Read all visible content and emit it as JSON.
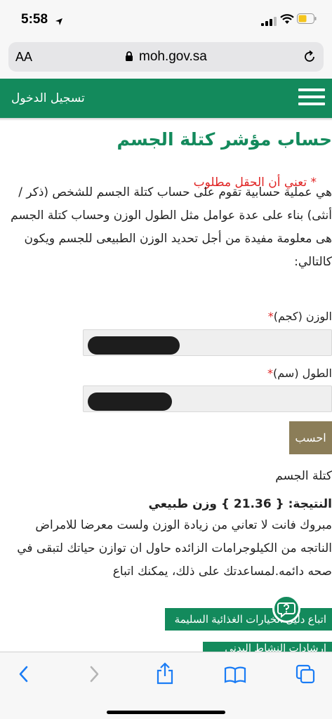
{
  "status_bar": {
    "time": "5:58",
    "icons": [
      "location-arrow-icon",
      "cellular-signal-icon",
      "wifi-icon",
      "battery-icon"
    ]
  },
  "browser": {
    "text_size_label": "AA",
    "url": "moh.gov.sa",
    "toolbar_icons": [
      "back-icon",
      "forward-icon",
      "share-icon",
      "bookmarks-icon",
      "tabs-icon"
    ]
  },
  "site_nav": {
    "login_label": "تسجيل الدخول",
    "menu_icon": "hamburger-menu-icon"
  },
  "page": {
    "title": "حساب مؤشر كتلة الجسم",
    "required_note": "*  تعني أن الحقل مطلوب",
    "description": "هي عملية حسابية تقوم على حساب كتلة الجسم للشخص (ذكر /أنثى) بناء على عدة عوامل مثل الطول الوزن وحساب كتلة الجسم هى معلومة مفيدة من أجل تحديد الوزن الطبيعى للجسم ويكون كالتالي:",
    "weight_label": "الوزن (كجم)",
    "height_label": "الطول (سم)",
    "required_star": "*",
    "calculate_label": "احسب",
    "result_heading": "كتلة الجسم",
    "result_line": "النتيجة: { 21.36 } وزن طبيعي",
    "result_message": "مبروك فانت لا تعاني من زيادة الوزن ولست معرضا للامراض الناتجه من الكيلوجرامات الزائده حاول ان توازن حياتك لتبقى في صحه دائمه.لمساعدتك على ذلك، يمكنك اتباع",
    "healthy_food_button": "اتباع دليل الخيارات الغذائية السليمة",
    "physical_activity_button": "إرشادات النشاط البدني"
  },
  "colors": {
    "brand_green": "#138a5c",
    "calc_button": "#8b7d58",
    "required_red": "#e02424",
    "ios_blue": "#1a7cf5"
  }
}
